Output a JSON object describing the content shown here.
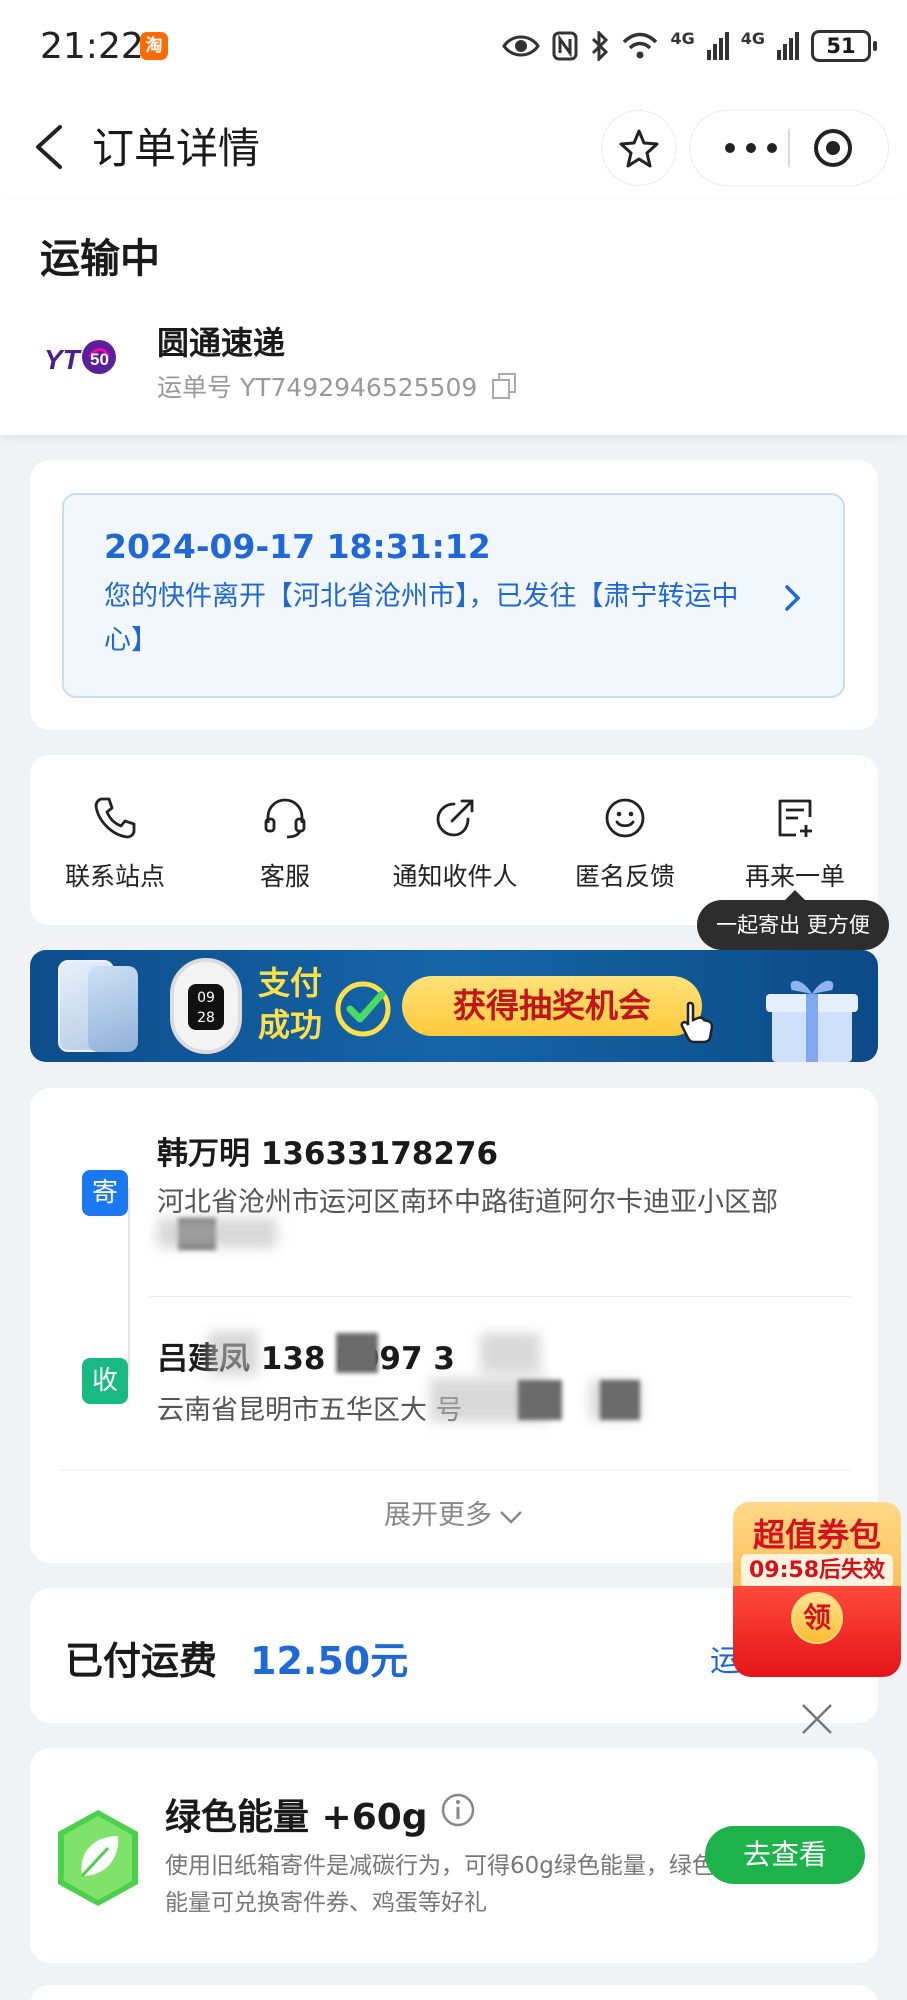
{
  "status_bar": {
    "time": "21:22",
    "app_badge": "淘",
    "network_1": "4G",
    "network_2": "4G",
    "battery": "51"
  },
  "nav": {
    "title": "订单详情"
  },
  "order": {
    "status": "运输中",
    "carrier_name": "圆通速递",
    "waybill": "运单号 YT7492946525509"
  },
  "tracking": {
    "time": "2024-09-17 18:31:12",
    "text": "您的快件离开【河北省沧州市】，已发往【肃宁转运中心】"
  },
  "actions": [
    {
      "label": "联系站点",
      "icon": "phone-icon"
    },
    {
      "label": "客服",
      "icon": "headset-icon"
    },
    {
      "label": "通知收件人",
      "icon": "share-icon"
    },
    {
      "label": "匿名反馈",
      "icon": "smile-icon"
    },
    {
      "label": "再来一单",
      "icon": "order-add-icon"
    }
  ],
  "tooltip": "一起寄出 更方便",
  "banner": {
    "pay_line1": "支付",
    "pay_line2": "成功",
    "lottery": "获得抽奖机会",
    "watch_time": "09 28"
  },
  "sender": {
    "badge": "寄",
    "name": "韩万明 13633178276",
    "address": "河北省沧州市运河区南环中路街道阿尔卡迪亚小区部"
  },
  "receiver": {
    "badge": "收",
    "name": "吕建凤 138 8097 3",
    "address": "云南省昆明市五华区大                   号"
  },
  "expand_more": "展开更多",
  "fee": {
    "label": "已付运费",
    "value": "12.50元",
    "link": "运"
  },
  "coupon": {
    "title": "超值券包",
    "timer": "09:58后失效",
    "claim": "领"
  },
  "energy": {
    "title": "绿色能量 +60g",
    "desc": "使用旧纸箱寄件是减碳行为，可得60g绿色能量，绿色能量可兑换寄件券、鸡蛋等好礼",
    "button": "去查看"
  },
  "colors": {
    "accent_blue": "#1f68d6",
    "sender_blue": "#1a78f2",
    "receiver_green": "#19b983",
    "energy_green": "#1db34a",
    "coupon_red": "#e4141a"
  }
}
